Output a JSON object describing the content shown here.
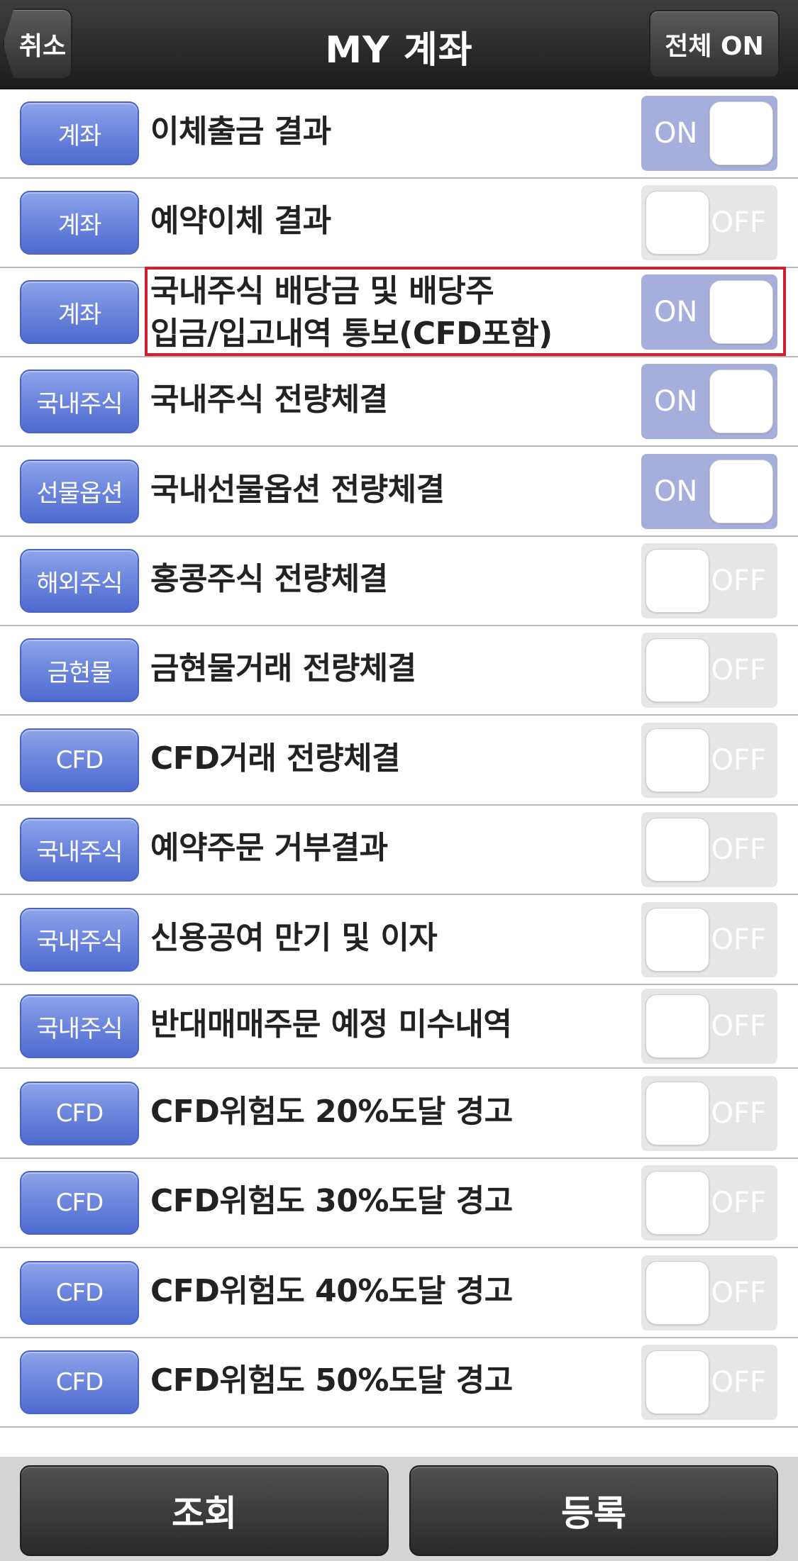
{
  "header": {
    "title": "MY 계좌",
    "cancel_label": "취소",
    "all_on_label": "전체 ON"
  },
  "toggle_labels": {
    "on": "ON",
    "off": "OFF"
  },
  "items": [
    {
      "tag": "계좌",
      "label": "이체출금 결과",
      "state": "on"
    },
    {
      "tag": "계좌",
      "label": "예약이체 결과",
      "state": "off"
    },
    {
      "tag": "계좌",
      "label": "국내주식 배당금 및 배당주",
      "label2": "입금/입고내역 통보(CFD포함)",
      "state": "on"
    },
    {
      "tag": "국내주식",
      "label": "국내주식 전량체결",
      "state": "on"
    },
    {
      "tag": "선물옵션",
      "label": "국내선물옵션 전량체결",
      "state": "on"
    },
    {
      "tag": "해외주식",
      "label": "홍콩주식 전량체결",
      "state": "off"
    },
    {
      "tag": "금현물",
      "label": "금현물거래 전량체결",
      "state": "off"
    },
    {
      "tag": "CFD",
      "label": "CFD거래 전량체결",
      "state": "off"
    },
    {
      "tag": "국내주식",
      "label": "예약주문 거부결과",
      "state": "off"
    },
    {
      "tag": "국내주식",
      "label": "신용공여 만기 및 이자",
      "state": "off"
    },
    {
      "tag": "국내주식",
      "label": "반대매매주문 예정 미수내역",
      "state": "off"
    },
    {
      "tag": "CFD",
      "label": "CFD위험도 20%도달 경고",
      "state": "off"
    },
    {
      "tag": "CFD",
      "label": "CFD위험도 30%도달 경고",
      "state": "off"
    },
    {
      "tag": "CFD",
      "label": "CFD위험도 40%도달 경고",
      "state": "off"
    },
    {
      "tag": "CFD",
      "label": "CFD위험도 50%도달 경고",
      "state": "off"
    }
  ],
  "footer": {
    "query_label": "조회",
    "register_label": "등록"
  },
  "colors": {
    "header_bg": "#2a2a2a",
    "tag_blue": "#6f88de",
    "toggle_on": "#a6afdb",
    "toggle_off": "#e6e6e6",
    "highlight": "#d02030"
  }
}
